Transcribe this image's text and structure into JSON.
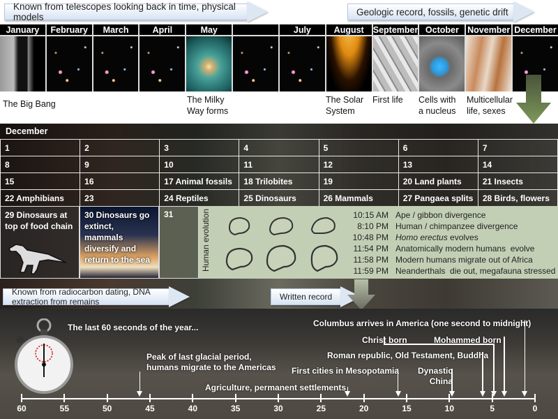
{
  "banners": {
    "telescopes": "Known from telescopes looking back in time, physical models",
    "geologic": "Geologic record, fossils, genetic drift",
    "radiocarbon": "Known from radiocarbon dating, DNA extraction from remains",
    "written": "Written record"
  },
  "months": [
    {
      "label": "January",
      "image": "big-bang-diagram"
    },
    {
      "label": "February",
      "image": "deep-field-galaxies"
    },
    {
      "label": "March",
      "image": "deep-field-galaxies"
    },
    {
      "label": "April",
      "image": "deep-field-galaxies"
    },
    {
      "label": "May",
      "image": "spiral-galaxy"
    },
    {
      "label": "",
      "image": "deep-field-galaxies"
    },
    {
      "label": "July",
      "image": "deep-field-galaxies"
    },
    {
      "label": "August",
      "image": "sun-and-planets"
    },
    {
      "label": "September",
      "image": "bacteria"
    },
    {
      "label": "October",
      "image": "cell-nucleus"
    },
    {
      "label": "November",
      "image": "multicellular-organism"
    },
    {
      "label": "December",
      "image": "deep-field-galaxies"
    }
  ],
  "captions": {
    "big_bang": "The Big Bang",
    "milky_way_1": "The Milky",
    "milky_way_2": "Way forms",
    "solar_1": "The Solar",
    "solar_2": "System",
    "first_life": "First life",
    "cells_1": "Cells with",
    "cells_2": "a nucleus",
    "multi_1": "Multicellular",
    "multi_2": "life, sexes"
  },
  "december": {
    "title": "December",
    "rows": [
      [
        "1",
        "2",
        "3",
        "4",
        "5",
        "6",
        "7"
      ],
      [
        "8",
        "9",
        "10",
        "11",
        "12",
        "13",
        "14"
      ],
      [
        "15",
        "16",
        "17 Animal fossils",
        "18 Trilobites",
        "19",
        "20 Land plants",
        "21 Insects"
      ],
      [
        "22 Amphibians",
        "23",
        "24 Reptiles",
        "25 Dinosaurs",
        "26 Mammals",
        "27 Pangaea splits",
        "28 Birds, flowers"
      ]
    ],
    "day29": "29 Dinosaurs at top of food chain",
    "day30": "30 Dinosaurs go extinct, mammals diversify and return to the sea",
    "day31": "31"
  },
  "human_evolution": {
    "label": "Human evolution",
    "events": [
      {
        "time": "10:15 AM",
        "text": "Ape / gibbon divergence"
      },
      {
        "time": "8:10 PM",
        "text": "Human / chimpanzee divergence"
      },
      {
        "time": "10:48 PM",
        "text_italic": "Homo erectus",
        "text": " evolves"
      },
      {
        "time": "11:54 PM",
        "text": "Anatomically modern humans  evolve"
      },
      {
        "time": "11:58 PM",
        "text": "Modern humans migrate out of Africa"
      },
      {
        "time": "11:59 PM",
        "text": "Neanderthals  die out, megafauna stressed"
      }
    ]
  },
  "last_minute": {
    "title": "The last 60 seconds of the year...",
    "axis": {
      "min": 60,
      "max": 0,
      "ticks": [
        60,
        55,
        50,
        45,
        40,
        35,
        30,
        25,
        20,
        15,
        10,
        5,
        0
      ]
    },
    "events": [
      {
        "id": "glacial",
        "lines": [
          "Peak of last glacial period,",
          "humans migrate to the Americas"
        ],
        "second": 46.2
      },
      {
        "id": "agriculture",
        "lines": [
          "Agriculture, permanent settlements"
        ],
        "second": 21.9
      },
      {
        "id": "cities",
        "lines": [
          "First cities in Mesopotamia"
        ],
        "second": 16
      },
      {
        "id": "china",
        "lines": [
          "Dynastic",
          "China"
        ],
        "second": 9.7
      },
      {
        "id": "roman",
        "lines": [
          "Roman republic, Old Testament, Buddha"
        ],
        "second": 6.1
      },
      {
        "id": "christ",
        "lines": [
          "Christ born"
        ],
        "second": 4.8
      },
      {
        "id": "mohammed",
        "lines": [
          "Mohammed born"
        ],
        "second": 3.6
      },
      {
        "id": "columbus",
        "lines": [
          "Columbus arrives in America (one second to midnight)"
        ],
        "second": 1.2
      }
    ]
  }
}
